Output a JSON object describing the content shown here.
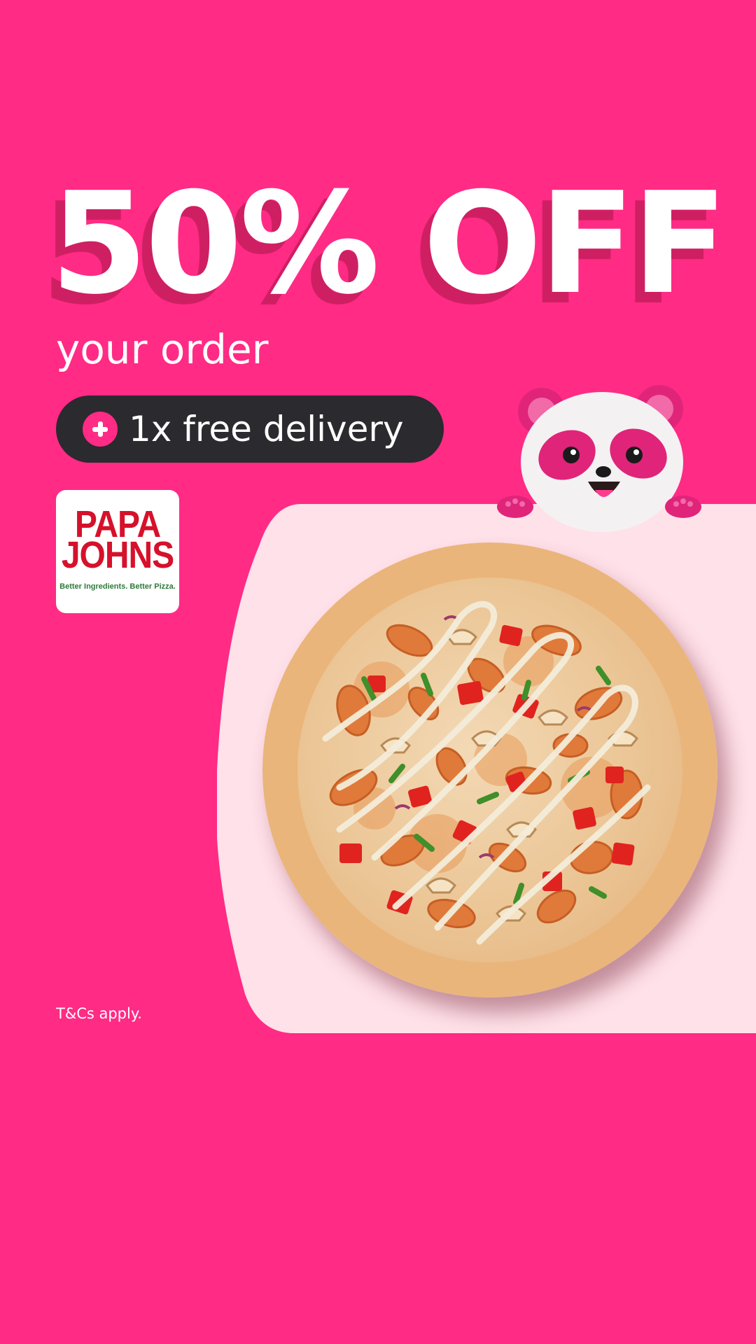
{
  "promo": {
    "headline": "50% OFF",
    "subline": "your order",
    "delivery_offer": "1x free delivery",
    "terms": "T&Cs apply."
  },
  "brand": {
    "name_line_1": "PAPA",
    "name_line_2": "JOHNS",
    "tagline": "Better Ingredients. Better Pizza."
  },
  "icons": {
    "delivery_badge": "plus-icon",
    "mascot": "panda-mascot",
    "food": "pizza-image"
  },
  "colors": {
    "background": "#FF2B85",
    "headline_shadow": "#CF1F63",
    "pill": "#2B2A2E",
    "card": "#FFE1E9",
    "brand_red": "#D6112B",
    "brand_green": "#2E7A3A"
  }
}
